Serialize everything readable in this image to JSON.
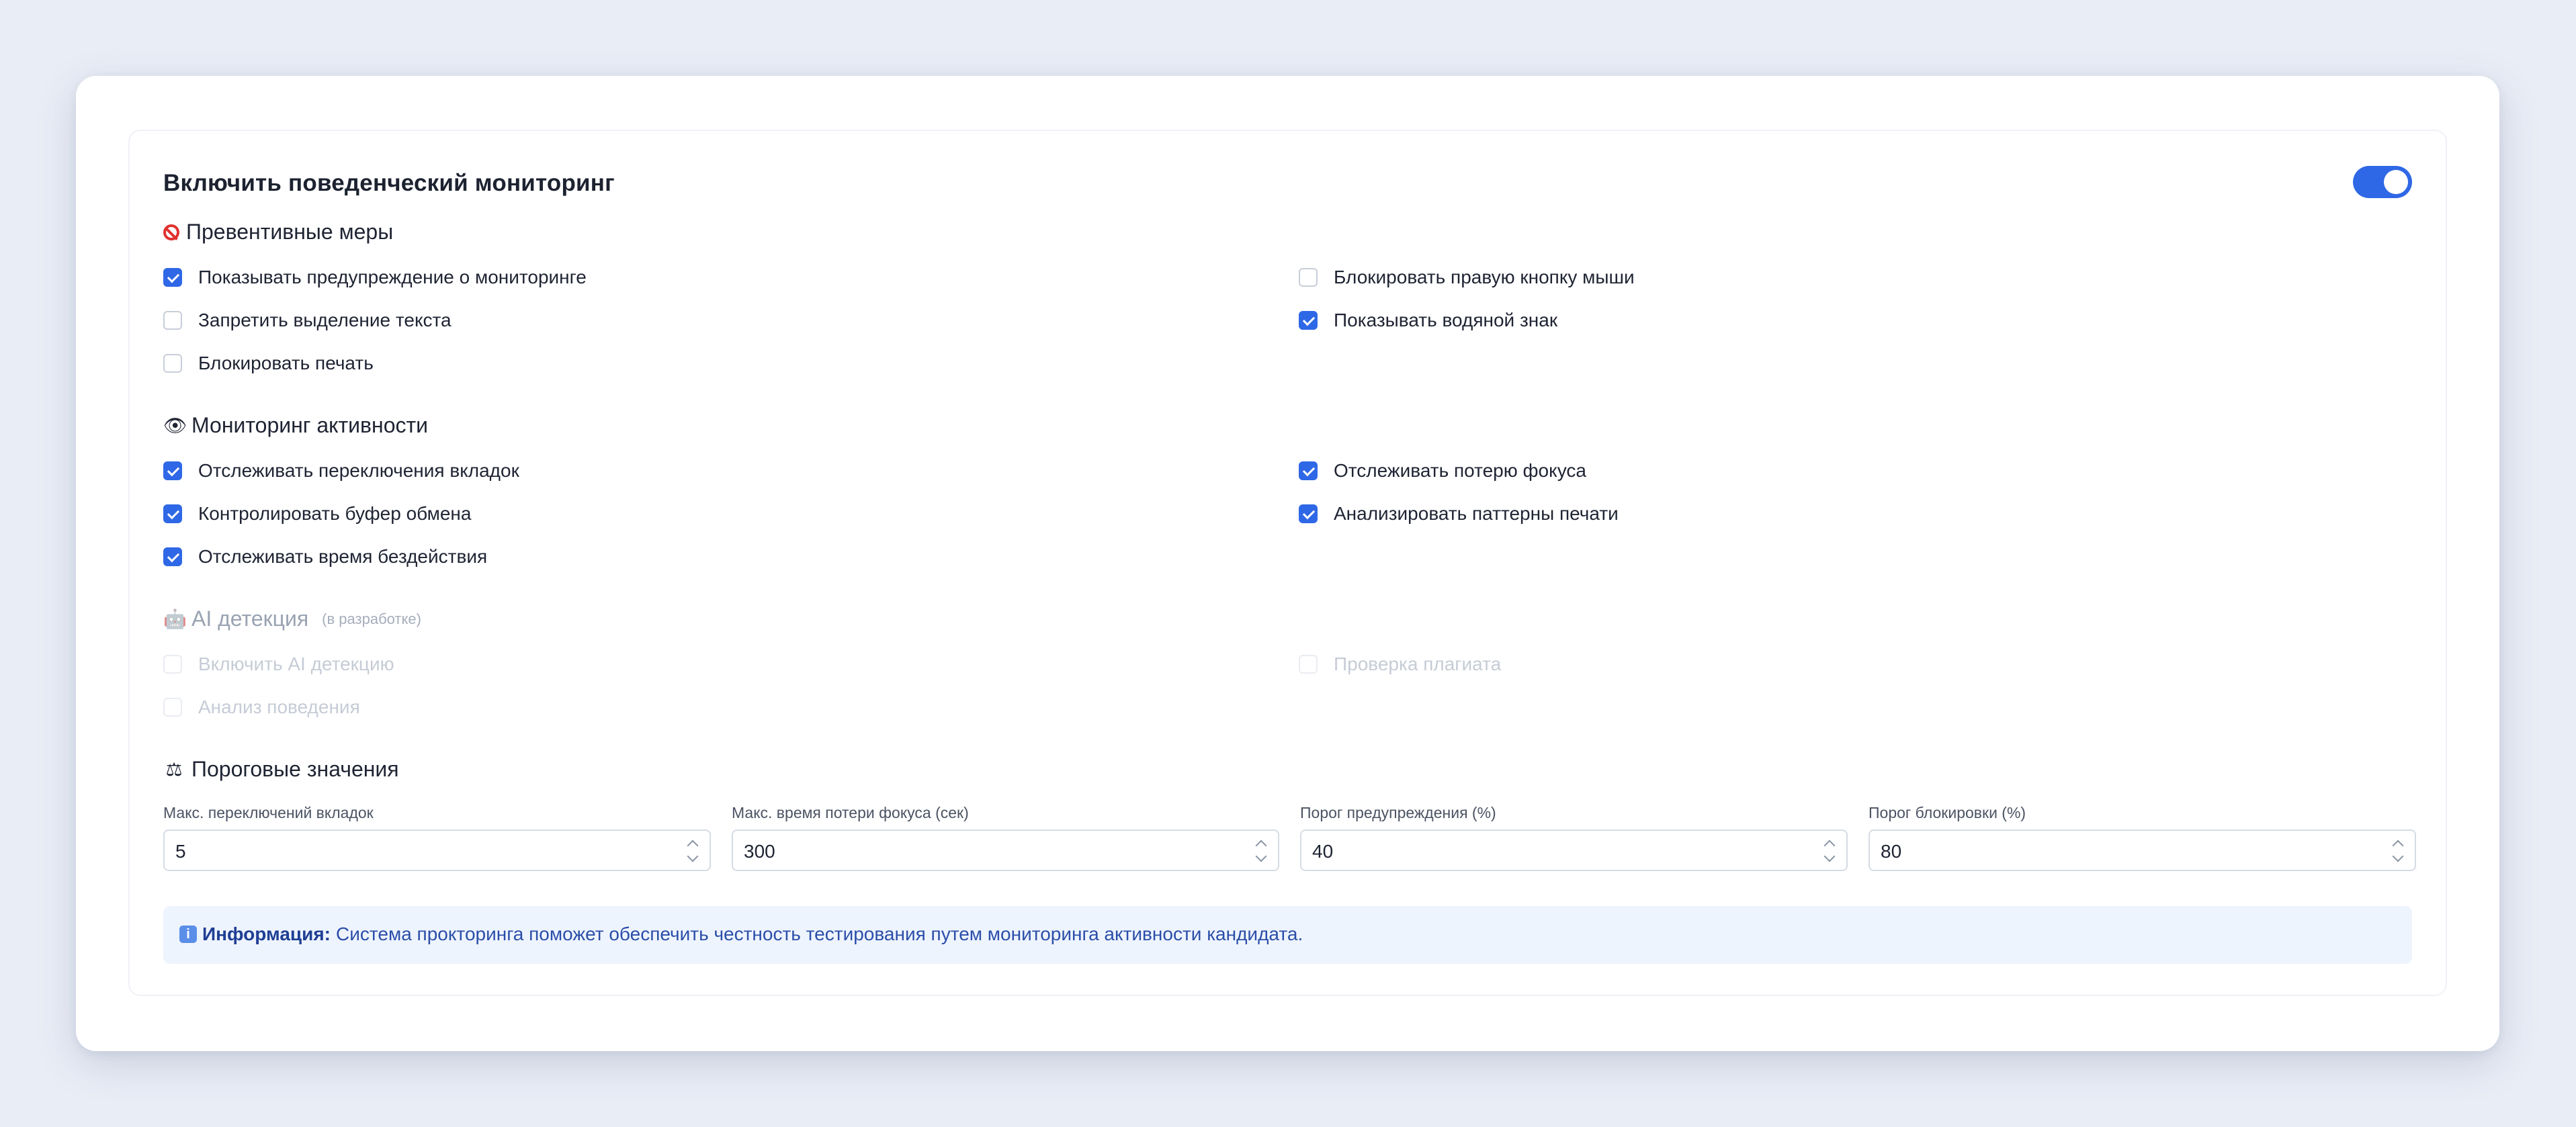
{
  "header": {
    "title": "Включить поведенческий мониторинг",
    "toggle_on": true
  },
  "sections": {
    "preventive": {
      "icon": "no-entry-icon",
      "title": "Превентивные меры",
      "options": [
        {
          "label": "Показывать предупреждение о мониторинге",
          "checked": true
        },
        {
          "label": "Блокировать правую кнопку мыши",
          "checked": false
        },
        {
          "label": "Запретить выделение текста",
          "checked": false
        },
        {
          "label": "Показывать водяной знак",
          "checked": true
        },
        {
          "label": "Блокировать печать",
          "checked": false
        }
      ]
    },
    "activity": {
      "icon": "eye-icon",
      "title": "Мониторинг активности",
      "options": [
        {
          "label": "Отслеживать переключения вкладок",
          "checked": true
        },
        {
          "label": "Отслеживать потерю фокуса",
          "checked": true
        },
        {
          "label": "Контролировать буфер обмена",
          "checked": true
        },
        {
          "label": "Анализировать паттерны печати",
          "checked": true
        },
        {
          "label": "Отслеживать время бездействия",
          "checked": true
        }
      ]
    },
    "ai": {
      "icon": "robot-icon",
      "title": "AI детекция",
      "hint": "(в разработке)",
      "options": [
        {
          "label": "Включить AI детекцию",
          "checked": false,
          "disabled": true
        },
        {
          "label": "Проверка плагиата",
          "checked": false,
          "disabled": true
        },
        {
          "label": "Анализ поведения",
          "checked": false,
          "disabled": true
        }
      ]
    },
    "thresholds": {
      "icon": "scales-icon",
      "title": "Пороговые значения",
      "fields": [
        {
          "label": "Макс. переключений вкладок",
          "value": "5"
        },
        {
          "label": "Макс. время потери фокуса (сек)",
          "value": "300"
        },
        {
          "label": "Порог предупреждения (%)",
          "value": "40"
        },
        {
          "label": "Порог блокировки (%)",
          "value": "80"
        }
      ]
    }
  },
  "info": {
    "icon": "info-icon",
    "strong": "Информация:",
    "text": "Система прокторинга поможет обеспечить честность тестирования путем мониторинга активности кандидата."
  },
  "colors": {
    "accent": "#2f68e6",
    "background": "#e9edf6",
    "info_bg": "#eef4fe"
  }
}
